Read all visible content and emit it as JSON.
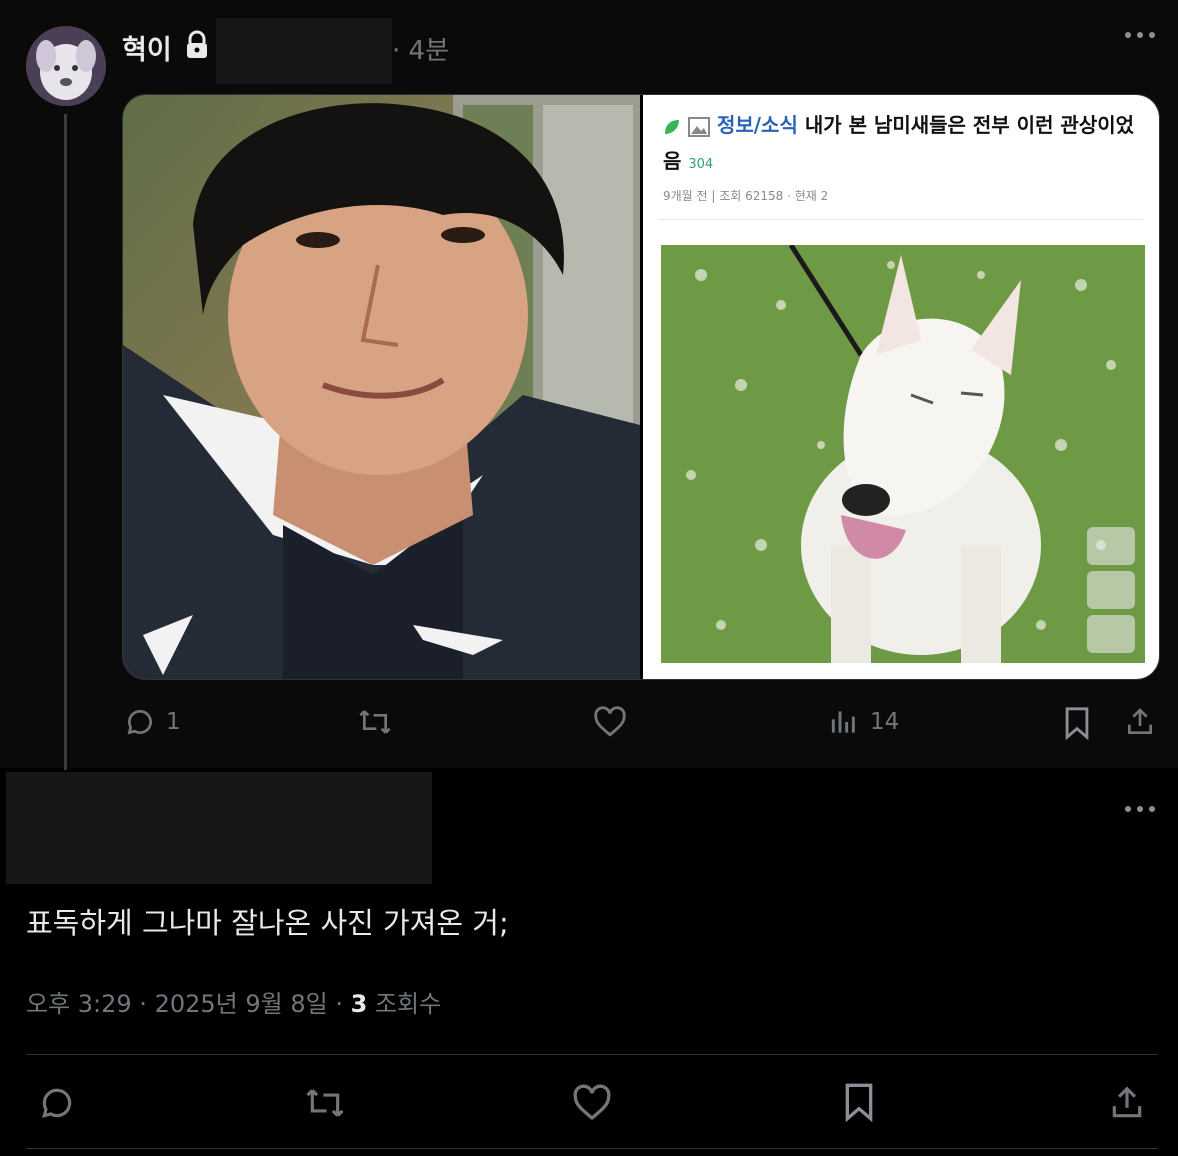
{
  "tweet": {
    "author_name": "혁이",
    "time_ago": "· 4분",
    "more_icon": "more-horizontal-icon",
    "lock_icon": "lock-icon",
    "embedded_post": {
      "category": "정보/소식",
      "title": "내가 본 남미새들은 전부 이런 관상이었음",
      "comment_count": "304",
      "meta": "9개월 전 | 조회 62158 · 현재 2"
    },
    "actions": {
      "replies": "1",
      "retweets": "",
      "likes": "",
      "views": "14"
    }
  },
  "reply": {
    "text": "표독하게 그나마 잘나온 사진 가져온 거;",
    "timestamp": "오후 3:29 · 2025년 9월 8일 ·",
    "views_count": "3",
    "views_label": "조회수"
  },
  "colors": {
    "background": "#000000",
    "secondary_text": "#71767b",
    "primary_text": "#e7e9ea",
    "category_blue": "#2b62b8"
  }
}
